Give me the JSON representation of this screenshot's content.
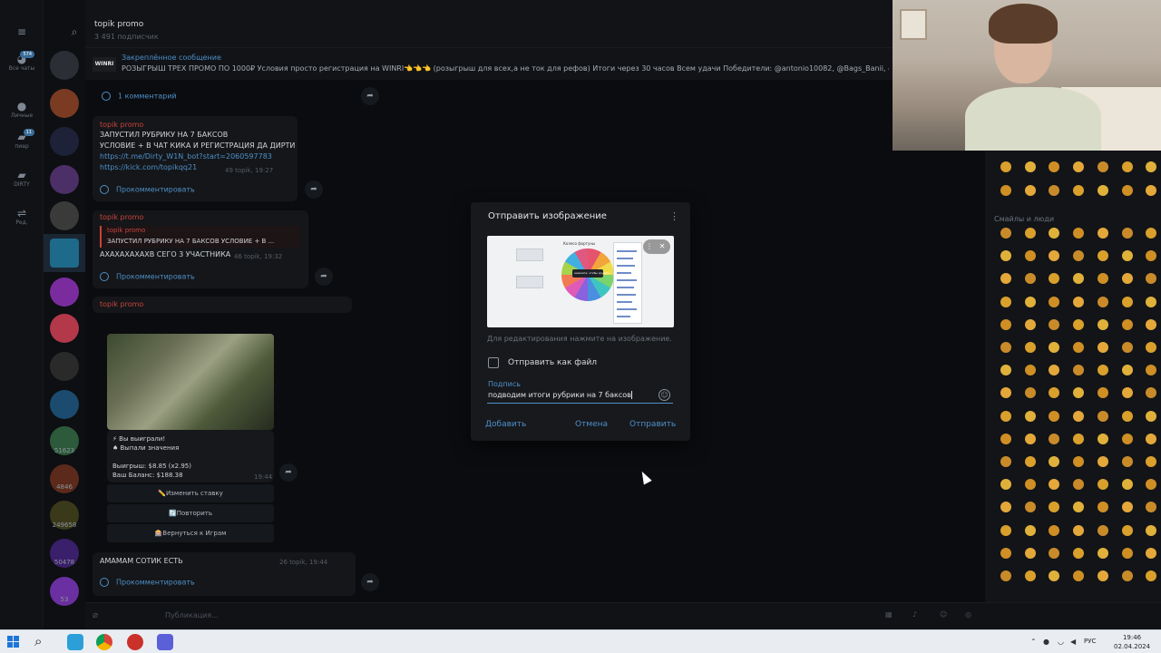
{
  "rail": {
    "items": [
      {
        "label": "Все чаты",
        "badge": "574"
      },
      {
        "label": "Личные",
        "badge": ""
      },
      {
        "label": "пиар",
        "badge": "11"
      },
      {
        "label": "DIRTY",
        "badge": ""
      },
      {
        "label": "Ред.",
        "badge": ""
      }
    ]
  },
  "chat_list": {
    "counts": [
      "1",
      "51623",
      "4846",
      "249658",
      "50478",
      "53"
    ]
  },
  "chat": {
    "title": "topik promo",
    "subscribers": "3 491 подписчик",
    "pinned_title": "Закреплённое сообщение",
    "pinned_logo": "WINRI",
    "pinned_text": "РОЗЫГРЫШ ТРЕХ ПРОМО ПО 1000₽ Условия просто регистрация на WINRI👈👈👈 (розыгрыш для всех,а не ток для рефов) Итоги через 30 часов Всем удачи  Победители: @antonio10082, @Bags_Banii, @ro",
    "comment_1": "1 комментарий",
    "msg1_author": "topik promo",
    "msg1_line1": "ЗАПУСТИЛ РУБРИКУ НА 7 БАКСОВ",
    "msg1_line2": "УСЛОВИЕ + В ЧАТ КИКА И РЕГИСТРАЦИЯ ДА ДИРТИ",
    "msg1_link1": "https://t.me/Dirty_W1N_bot?start=2060597783",
    "msg1_link2": "https://kick.com/topikqq21",
    "msg1_meta": "49  topik, 19:27",
    "msg_comment_label": "Прокомментировать",
    "msg2_author": "topik promo",
    "msg2_quote_author": "topik promo",
    "msg2_quote_text": "ЗАПУСТИЛ РУБРИКУ НА 7 БАКСОВ УСЛОВИЕ + В ...",
    "msg2_text": "АХАХАХАХАХВ СЕГО 3 УЧАСТНИКА",
    "msg2_meta": "46  topik, 19:32",
    "msg3_author": "topik promo",
    "game_win": "⚡ Вы выиграли!",
    "game_fell": "♠ Выпали значения",
    "game_amount": "Выигрыш: $8.85 (x2.95)",
    "game_balance": "Ваш Баланс: $188.38",
    "game_btn_change": "✏️Изменить ставку",
    "game_btn_repeat": "🔄Повторить",
    "game_btn_back": "🎰Вернуться к Играм",
    "game_time": "19:44",
    "msg4_text": "АМАМАМ СОТИК ЕСТЬ",
    "msg4_meta": "26  topik, 19:44",
    "composer_placeholder": "Публикация..."
  },
  "emoji_panel": {
    "section_title": "Смайлы и люди"
  },
  "dialog": {
    "title": "Отправить изображение",
    "hint": "Для редактирования нажмите на изображение.",
    "send_as_file": "Отправить как файл",
    "caption_label": "Подпись",
    "caption_value": "подводим итоги рубрики на 7 баксов",
    "btn_add": "Добавить",
    "btn_cancel": "Отмена",
    "btn_send": "Отправить",
    "preview_header": "Колесо фортуны",
    "preview_center": "нажмите, чтобы крутить"
  },
  "taskbar": {
    "lang": "РУС",
    "time": "19:46",
    "date": "02.04.2024"
  },
  "colors": {
    "accent": "#4f8fc8",
    "author": "#c9433c",
    "dialog_bg": "#17191d"
  }
}
